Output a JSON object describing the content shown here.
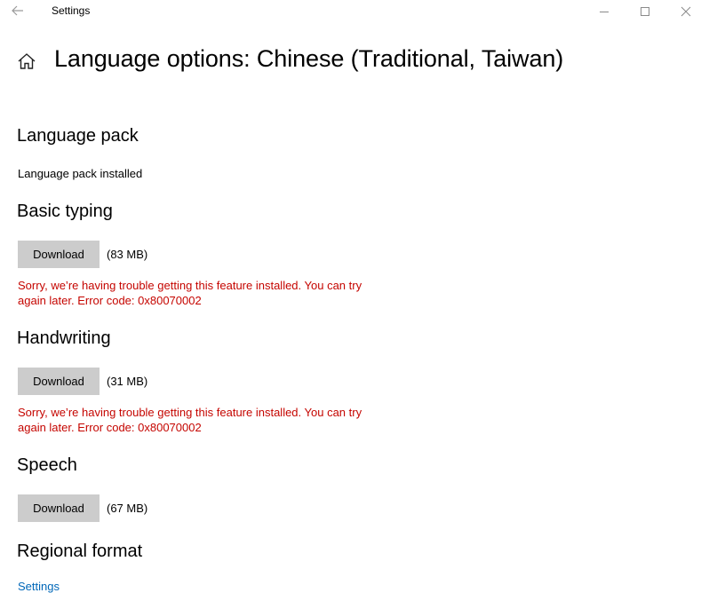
{
  "window": {
    "app_title": "Settings"
  },
  "header": {
    "title": "Language options: Chinese (Traditional, Taiwan)"
  },
  "sections": {
    "language_pack": {
      "heading": "Language pack",
      "status": "Language pack installed"
    },
    "basic_typing": {
      "heading": "Basic typing",
      "button_label": "Download",
      "size": "(83 MB)",
      "error_line1": "Sorry, we’re having trouble getting this feature installed. You can try",
      "error_line2": "again later. Error code: 0x80070002"
    },
    "handwriting": {
      "heading": "Handwriting",
      "button_label": "Download",
      "size": "(31 MB)",
      "error_line1": "Sorry, we’re having trouble getting this feature installed. You can try",
      "error_line2": "again later. Error code: 0x80070002"
    },
    "speech": {
      "heading": "Speech",
      "button_label": "Download",
      "size": "(67 MB)"
    },
    "regional_format": {
      "heading": "Regional format",
      "link_label": "Settings"
    }
  },
  "colors": {
    "error": "#c50500",
    "link": "#0067b8",
    "button_bg": "#cccccc"
  },
  "icons": {
    "back": "back-arrow-icon",
    "home": "home-icon",
    "minimize": "minimize-icon",
    "maximize": "maximize-icon",
    "close": "close-icon"
  }
}
